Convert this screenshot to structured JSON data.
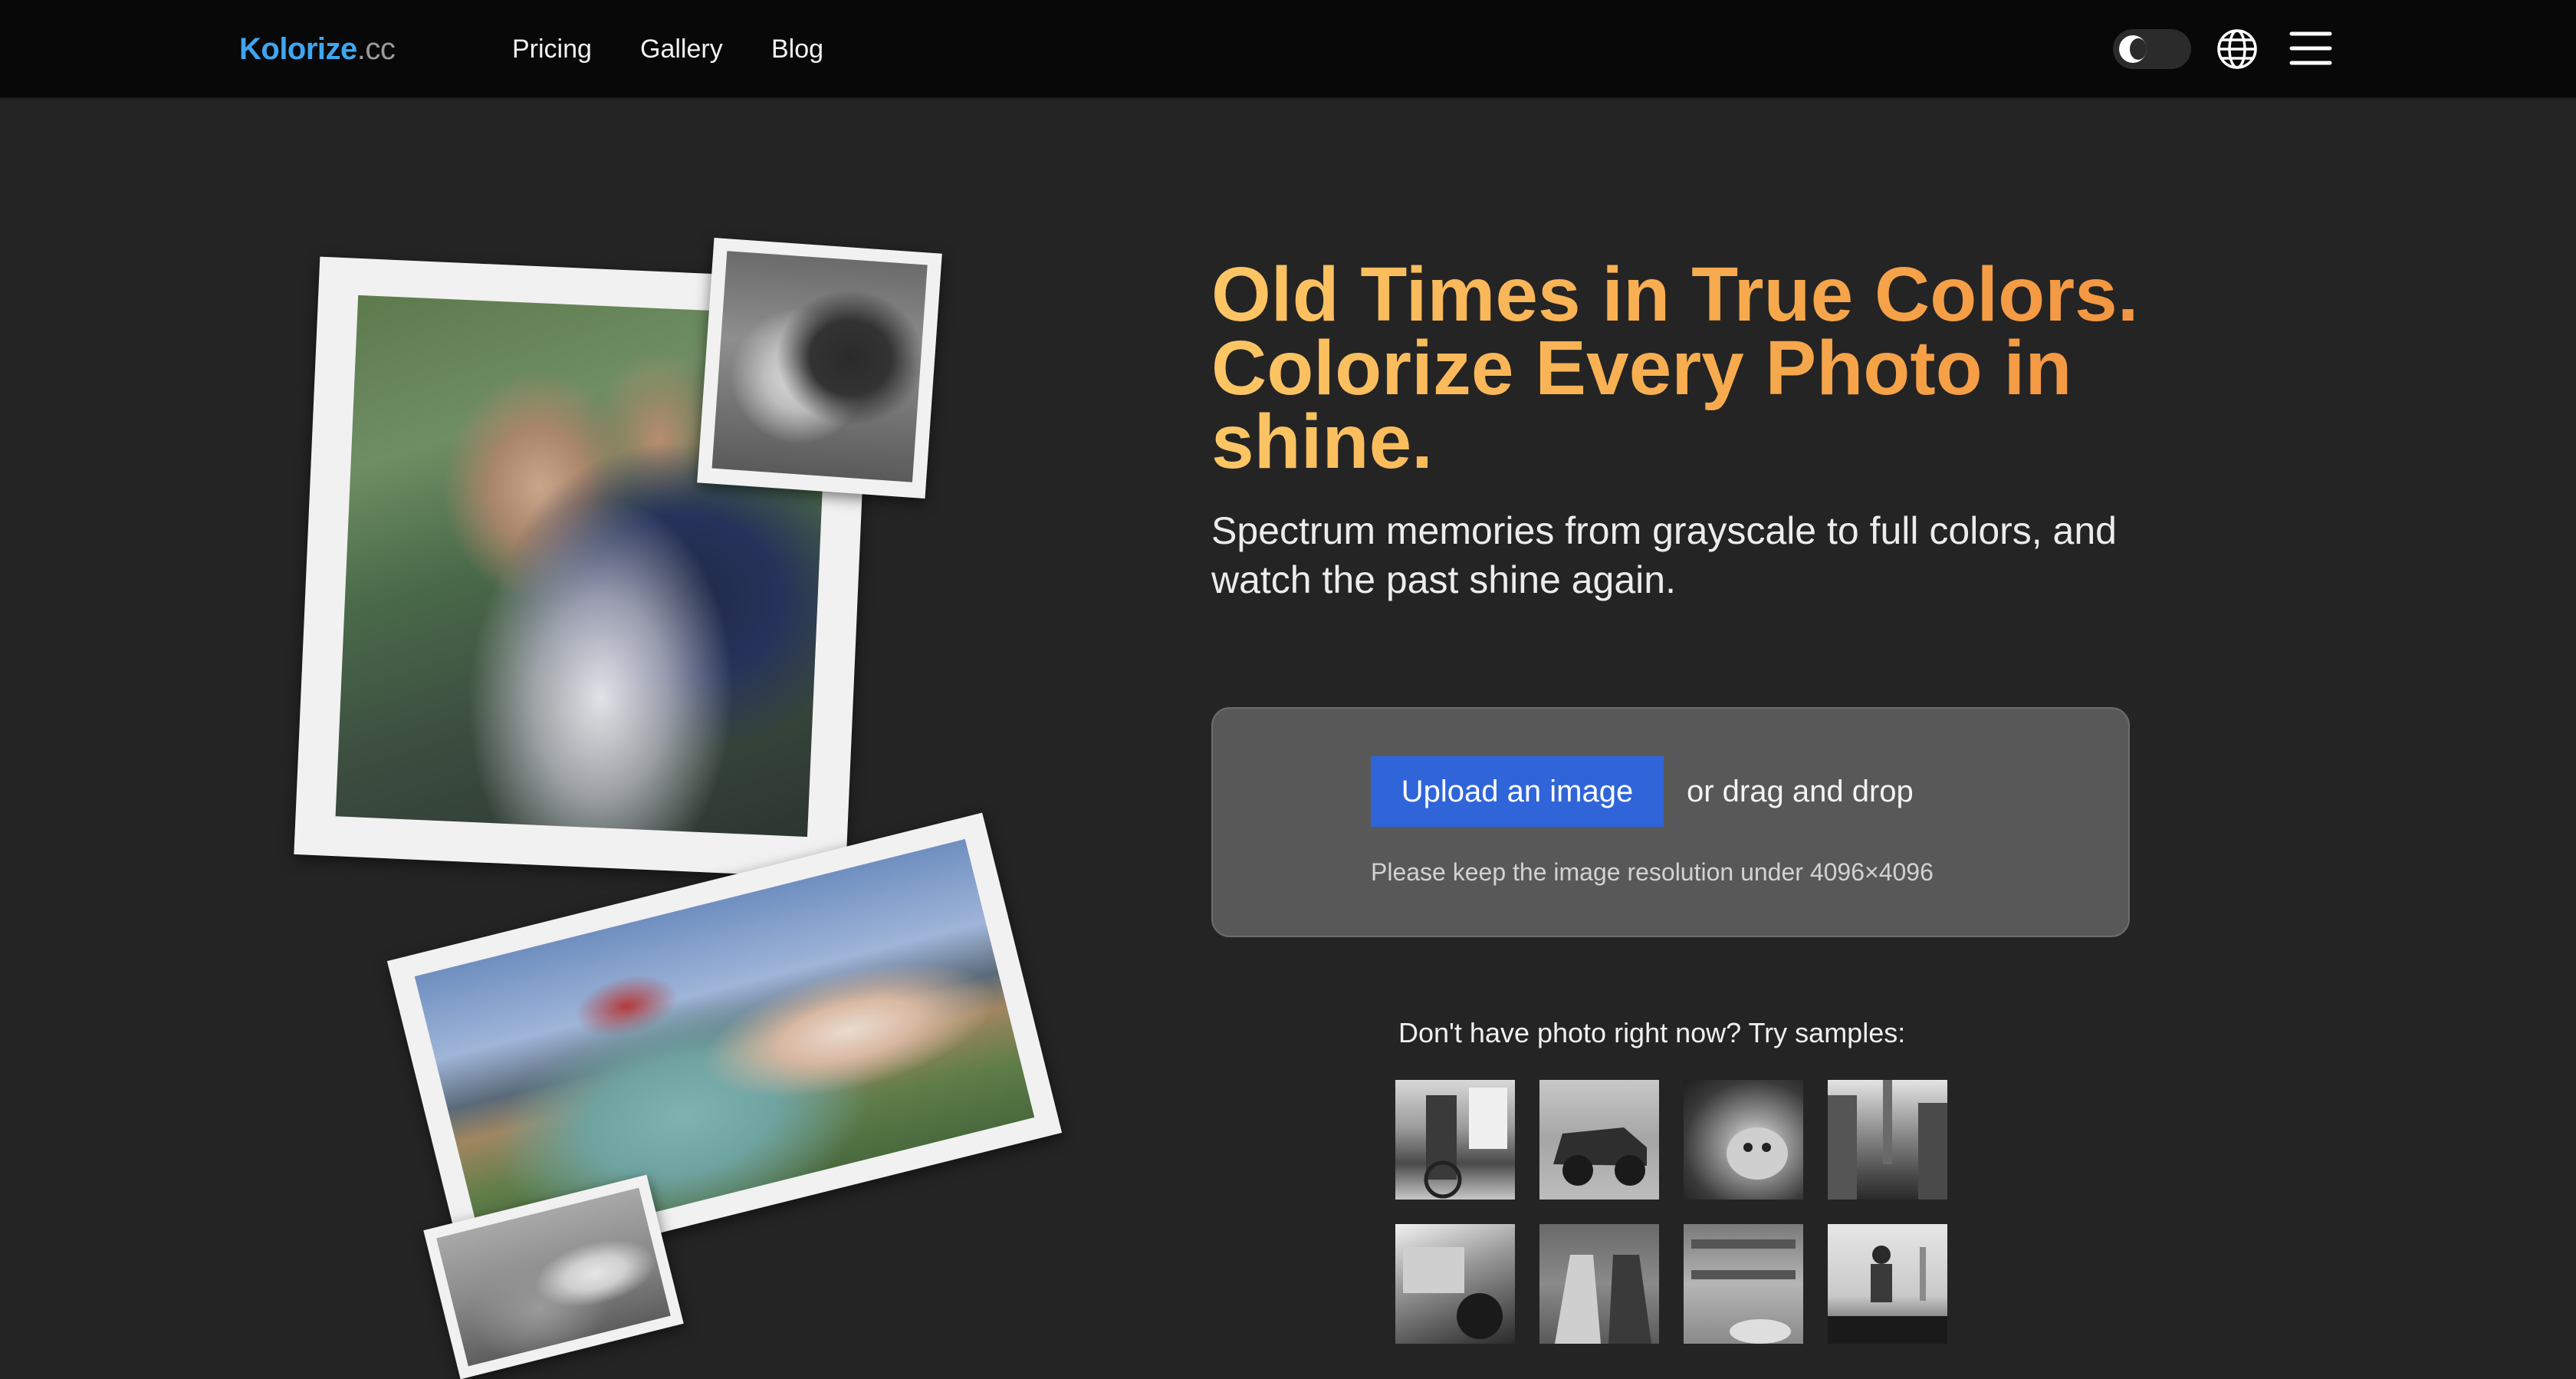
{
  "header": {
    "logo_main": "Kolorize",
    "logo_tld": ".cc",
    "nav": [
      {
        "label": "Pricing"
      },
      {
        "label": "Gallery"
      },
      {
        "label": "Blog"
      }
    ],
    "icons": {
      "theme_toggle": "moon-icon",
      "language": "globe-icon",
      "menu": "hamburger-menu-icon"
    }
  },
  "hero": {
    "title": "Old Times in True Colors. Colorize Every Photo in shine.",
    "subtitle": "Spectrum memories from grayscale to full colors, and watch the past shine again.",
    "title_gradient": [
      "#fcc665",
      "#f39240"
    ]
  },
  "upload": {
    "button_label": "Upload an image",
    "drag_text": "or drag and drop",
    "hint": "Please keep the image resolution under 4096×4096",
    "accent_color": "#2f65d9"
  },
  "samples": {
    "label": "Don't have photo right now? Try samples:",
    "items": [
      {
        "name": "sample-street-telephone"
      },
      {
        "name": "sample-vintage-car"
      },
      {
        "name": "sample-cat"
      },
      {
        "name": "sample-city-street"
      },
      {
        "name": "sample-car-interior"
      },
      {
        "name": "sample-royal-couple"
      },
      {
        "name": "sample-shop-interior"
      },
      {
        "name": "sample-empire-state"
      }
    ]
  }
}
